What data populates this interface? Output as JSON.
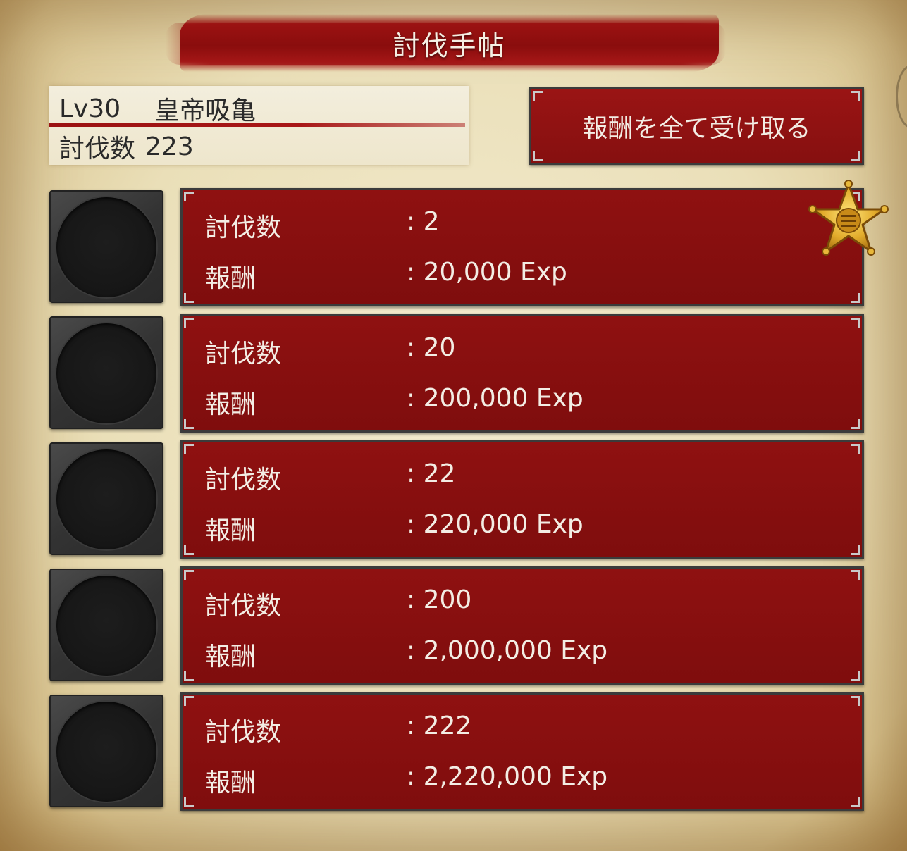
{
  "header": {
    "title": "討伐手帖"
  },
  "monster": {
    "level": "Lv30",
    "name": "皇帝吸亀",
    "kill_label": "討伐数",
    "kill_count": "223"
  },
  "claim_all_button": {
    "label": "報酬を全て受け取る"
  },
  "rewards": [
    {
      "count_label": "討伐数",
      "count_value": ": 2",
      "reward_label": "報酬",
      "reward_value": ": 20,000 Exp",
      "achieved": true
    },
    {
      "count_label": "討伐数",
      "count_value": ": 20",
      "reward_label": "報酬",
      "reward_value": ": 200,000 Exp",
      "achieved": false
    },
    {
      "count_label": "討伐数",
      "count_value": ": 22",
      "reward_label": "報酬",
      "reward_value": ": 220,000 Exp",
      "achieved": false
    },
    {
      "count_label": "討伐数",
      "count_value": ": 200",
      "reward_label": "報酬",
      "reward_value": ": 2,000,000 Exp",
      "achieved": false
    },
    {
      "count_label": "討伐数",
      "count_value": ": 222",
      "reward_label": "報酬",
      "reward_value": ": 2,220,000 Exp",
      "achieved": false
    }
  ],
  "icons": {
    "reward_slot": "empty-slot-icon",
    "badge": "sheriff-star-icon"
  },
  "colors": {
    "panel_red": "#861010",
    "parchment": "#eadfb8",
    "badge_gold": "#e0a82a"
  }
}
